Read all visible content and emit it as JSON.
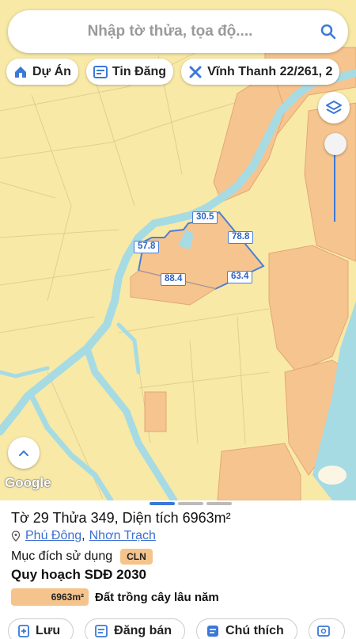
{
  "search": {
    "placeholder": "Nhập tờ thửa, tọa độ....",
    "icon": "search-icon"
  },
  "chips": [
    {
      "label": "Dự Án",
      "icon": "house-icon"
    },
    {
      "label": "Tin Đăng",
      "icon": "newspaper-icon"
    },
    {
      "label": "Vĩnh Thanh 22/261, 2",
      "icon": "tools-icon"
    }
  ],
  "map": {
    "dimensions": [
      "30.5",
      "78.8",
      "57.8",
      "88.4",
      "63.4"
    ],
    "attribution": "Google",
    "colors": {
      "land": "#f8e9a7",
      "parcel": "#f6c48f",
      "water": "#a6dbe4",
      "outline": "#4a7fd6"
    }
  },
  "sheet": {
    "title": "Tờ 29 Thửa 349, Diện tích 6963m²",
    "ward": "Phú Đông",
    "sep": ",",
    "district": "Nhơn Trạch",
    "purpose_label": "Mục đích sử dụng",
    "purpose_code": "CLN",
    "plan_title": "Quy hoạch SDĐ 2030",
    "plan_area": "6963m²",
    "plan_land": "Đất trồng cây lâu năm"
  },
  "actions": [
    {
      "label": "Lưu",
      "icon": "save-icon"
    },
    {
      "label": "Đăng bán",
      "icon": "post-sale-icon"
    },
    {
      "label": "Chú thích",
      "icon": "legend-icon"
    }
  ]
}
